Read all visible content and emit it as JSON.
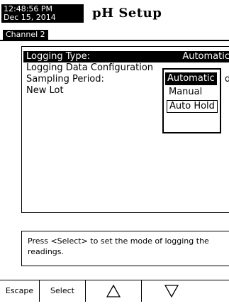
{
  "header": {
    "time": "12:48:56 PM",
    "date": "Dec 15, 2014",
    "title": "pH Setup",
    "channel": "Channel 2"
  },
  "menu": {
    "items": [
      {
        "label": "Logging Type:",
        "value": "Automatic",
        "selected": true
      },
      {
        "label": "Logging Data Configuration",
        "trail": "",
        "selected": false
      },
      {
        "label": "Sampling Period:",
        "trail": "d",
        "selected": false
      },
      {
        "label": "New Lot",
        "selected": false
      }
    ]
  },
  "dropdown": {
    "options": [
      "Automatic",
      "Manual",
      "Auto Hold"
    ],
    "highlighted": "Automatic"
  },
  "help": {
    "text": "Press <Select> to set the mode of logging the readings."
  },
  "softkeys": {
    "escape": "Escape",
    "select": "Select",
    "up_icon": "up-triangle-icon",
    "down_icon": "down-triangle-icon"
  }
}
